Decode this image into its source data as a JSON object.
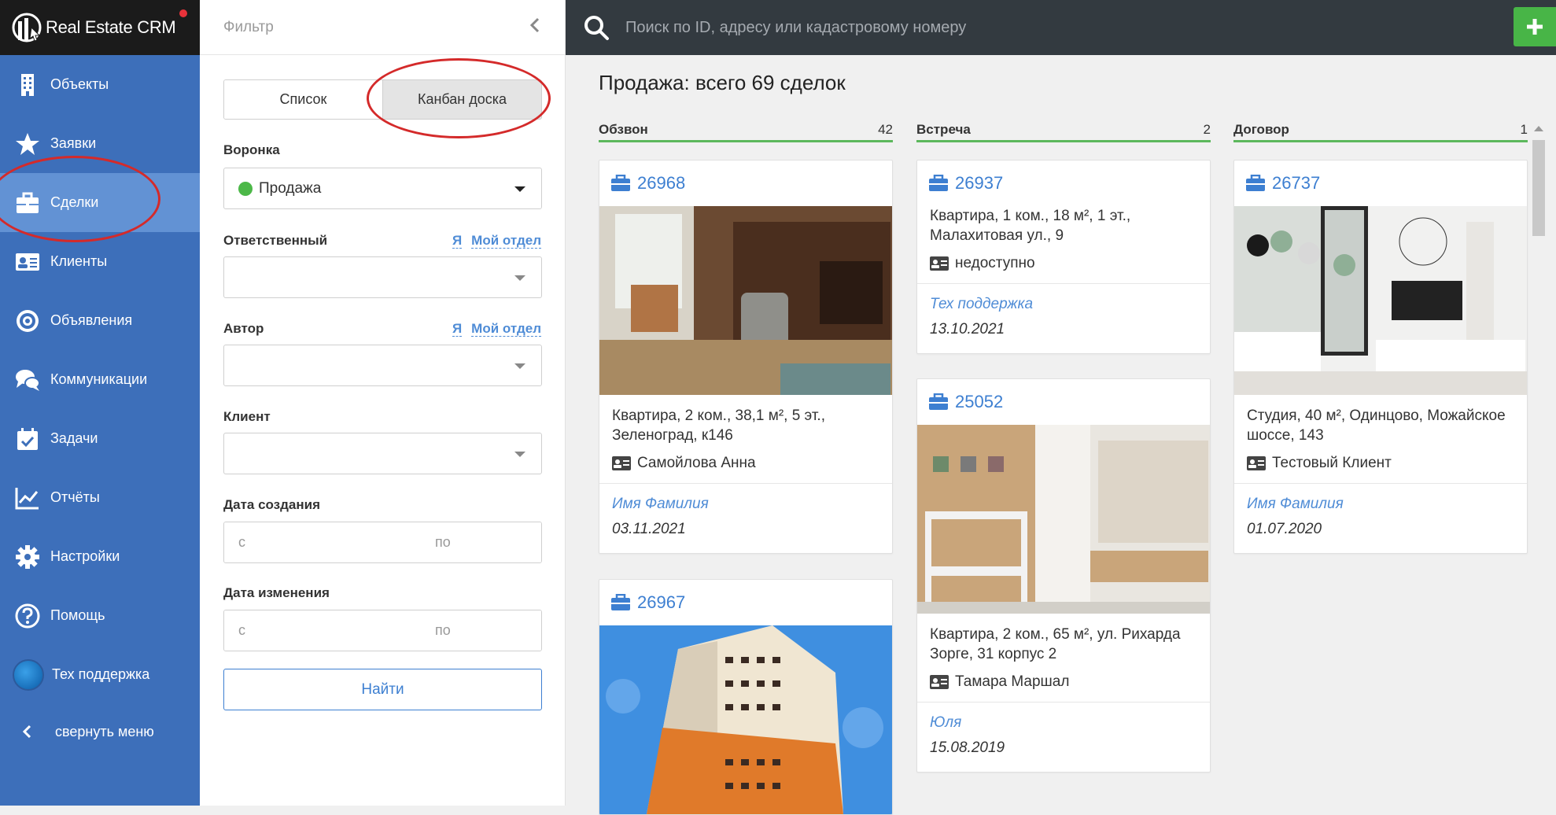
{
  "app": {
    "title": "Real Estate CRM"
  },
  "sidebar": {
    "items": [
      {
        "label": "Объекты",
        "icon": "building-icon"
      },
      {
        "label": "Заявки",
        "icon": "star-icon"
      },
      {
        "label": "Сделки",
        "icon": "briefcase-icon",
        "active": true
      },
      {
        "label": "Клиенты",
        "icon": "id-card-icon"
      },
      {
        "label": "Объявления",
        "icon": "target-icon"
      },
      {
        "label": "Коммуникации",
        "icon": "chat-icon"
      },
      {
        "label": "Задачи",
        "icon": "calendar-check-icon"
      },
      {
        "label": "Отчёты",
        "icon": "chart-line-icon"
      },
      {
        "label": "Настройки",
        "icon": "gear-icon"
      },
      {
        "label": "Помощь",
        "icon": "question-icon"
      }
    ],
    "support": "Тех поддержка",
    "collapse": "свернуть меню"
  },
  "filter": {
    "title": "Фильтр",
    "view_list": "Список",
    "view_kanban": "Канбан доска",
    "funnel_label": "Воронка",
    "funnel_value": "Продажа",
    "responsible_label": "Ответственный",
    "author_label": "Автор",
    "link_me": "Я",
    "link_dept": "Мой отдел",
    "client_label": "Клиент",
    "created_label": "Дата создания",
    "modified_label": "Дата изменения",
    "from_ph": "с",
    "to_ph": "по",
    "find_button": "Найти"
  },
  "search": {
    "placeholder": "Поиск по ID, адресу или кадастровому номеру"
  },
  "main": {
    "title": "Продажа: всего 69 сделок",
    "columns": [
      {
        "name": "Обзвон",
        "count": "42"
      },
      {
        "name": "Встреча",
        "count": "2"
      },
      {
        "name": "Договор",
        "count": "1"
      }
    ],
    "cards": {
      "c26968": {
        "id": "26968",
        "desc": "Квартира, 2 ком., 38,1 м², 5 эт., Зеленоград, к146",
        "client": "Самойлова Анна",
        "user": "Имя Фамилия",
        "date": "03.11.2021"
      },
      "c26967": {
        "id": "26967"
      },
      "c26937": {
        "id": "26937",
        "desc": "Квартира, 1 ком., 18 м², 1 эт., Малахитовая ул., 9",
        "client": "недоступно",
        "user": "Тех поддержка",
        "date": "13.10.2021"
      },
      "c25052": {
        "id": "25052",
        "desc": "Квартира, 2 ком., 65 м², ул. Рихарда Зорге, 31 корпус 2",
        "client": "Тамара Маршал",
        "user": "Юля",
        "date": "15.08.2019"
      },
      "c26737": {
        "id": "26737",
        "desc": "Студия, 40 м², Одинцово, Можайское шоссе, 143",
        "client": "Тестовый Клиент",
        "user": "Имя Фамилия",
        "date": "01.07.2020"
      }
    }
  },
  "colors": {
    "sidebar": "#3d6fba",
    "active": "#6292d4",
    "accent": "#3d7fd1",
    "green": "#4cb848",
    "topbar": "#333a40"
  }
}
